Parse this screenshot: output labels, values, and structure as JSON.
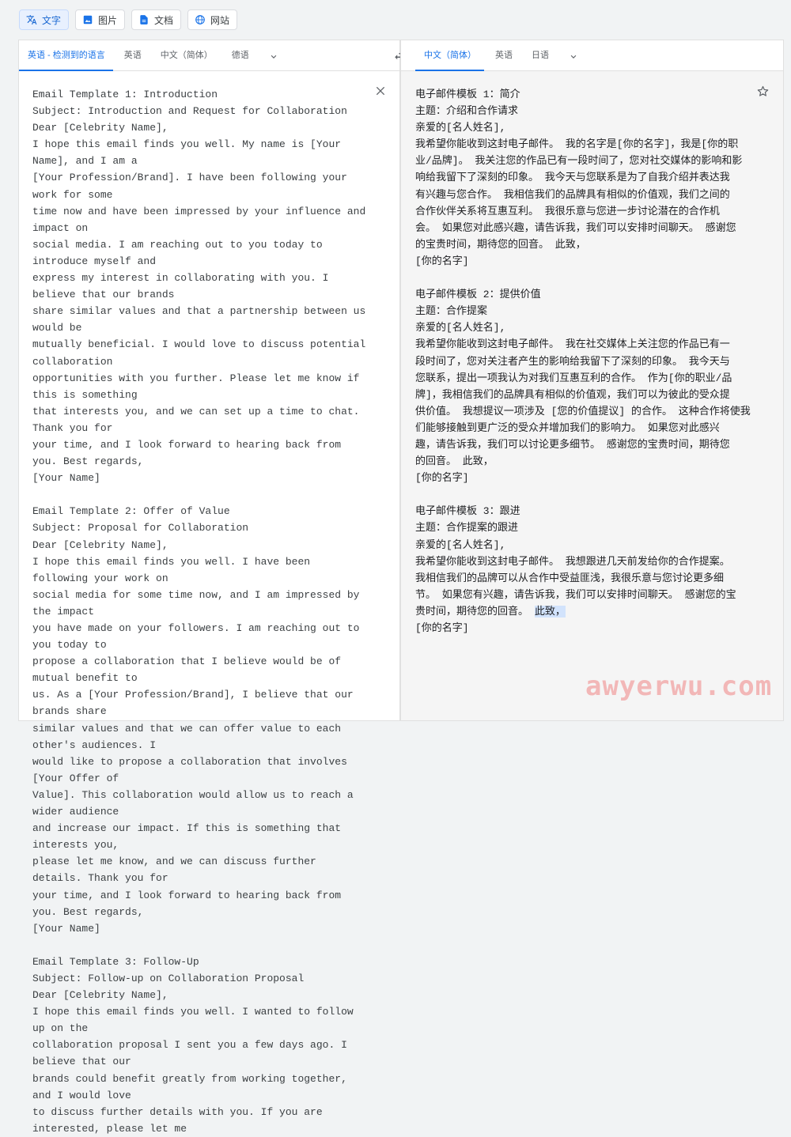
{
  "modes": [
    {
      "label": "文字",
      "icon": "translate-icon",
      "active": true
    },
    {
      "label": "图片",
      "icon": "image-icon",
      "active": false
    },
    {
      "label": "文档",
      "icon": "document-icon",
      "active": false
    },
    {
      "label": "网站",
      "icon": "globe-icon",
      "active": false
    }
  ],
  "source": {
    "tabs": [
      "英语 - 检测到的语言",
      "英语",
      "中文（简体）",
      "德语"
    ],
    "active_tab": 0,
    "lines": [
      "Email Template 1: Introduction",
      "Subject: Introduction and Request for Collaboration",
      "Dear [Celebrity Name],",
      "I hope this email finds you well. My name is [Your Name], and I am a",
      "[Your Profession/Brand]. I have been following your work for some",
      "time now and have been impressed by your influence and impact on",
      "social media. I am reaching out to you today to introduce myself and",
      "express my interest in collaborating with you. I believe that our brands",
      "share similar values and that a partnership between us would be",
      "mutually beneficial. I would love to discuss potential collaboration",
      "opportunities with you further. Please let me know if this is something",
      "that interests you, and we can set up a time to chat. Thank you for",
      "your time, and I look forward to hearing back from you. Best regards,",
      "[Your Name]",
      "",
      "Email Template 2: Offer of Value",
      "Subject: Proposal for Collaboration",
      "Dear [Celebrity Name],",
      "I hope this email finds you well. I have been following your work on",
      "social media for some time now, and I am impressed by the impact",
      "you have made on your followers. I am reaching out to you today to",
      "propose a collaboration that I believe would be of mutual benefit to",
      "us. As a [Your Profession/Brand], I believe that our brands share",
      "similar values and that we can offer value to each other's audiences. I",
      "would like to propose a collaboration that involves [Your Offer of",
      "Value]. This collaboration would allow us to reach a wider audience",
      "and increase our impact. If this is something that interests you,",
      "please let me know, and we can discuss further details. Thank you for",
      "your time, and I look forward to hearing back from you. Best regards,",
      "[Your Name]",
      "",
      "Email Template 3: Follow-Up",
      "Subject: Follow-up on Collaboration Proposal",
      "Dear [Celebrity Name],",
      "I hope this email finds you well. I wanted to follow up on the",
      "collaboration proposal I sent you a few days ago. I believe that our",
      "brands could benefit greatly from working together, and I would love",
      "to discuss further details with you. If you are interested, please let me"
    ]
  },
  "target": {
    "tabs": [
      "中文（简体）",
      "英语",
      "日语"
    ],
    "active_tab": 0,
    "lines": [
      "电子邮件模板 1：简介",
      "主题：介绍和合作请求",
      "亲爱的[名人姓名],",
      "我希望你能收到这封电子邮件。 我的名字是[你的名字]，我是[你的职",
      "业/品牌]。 我关注您的作品已有一段时间了，您对社交媒体的影响和影",
      "响给我留下了深刻的印象。 我今天与您联系是为了自我介绍并表达我",
      "有兴趣与您合作。 我相信我们的品牌具有相似的价值观，我们之间的",
      "合作伙伴关系将互惠互利。 我很乐意与您进一步讨论潜在的合作机",
      "会。 如果您对此感兴趣，请告诉我，我们可以安排时间聊天。 感谢您",
      "的宝贵时间，期待您的回音。 此致，",
      "[你的名字]",
      "",
      "电子邮件模板 2：提供价值",
      "主题：合作提案",
      "亲爱的[名人姓名],",
      "我希望你能收到这封电子邮件。 我在社交媒体上关注您的作品已有一",
      "段时间了，您对关注者产生的影响给我留下了深刻的印象。 我今天与",
      "您联系，提出一项我认为对我们互惠互利的合作。 作为[你的职业/品",
      "牌]，我相信我们的品牌具有相似的价值观，我们可以为彼此的受众提",
      "供价值。 我想提议一项涉及 [您的价值提议] 的合作。 这种合作将使我",
      "们能够接触到更广泛的受众并增加我们的影响力。 如果您对此感兴",
      "趣，请告诉我，我们可以讨论更多细节。 感谢您的宝贵时间，期待您",
      "的回音。 此致，",
      "[你的名字]",
      "",
      "电子邮件模板 3：跟进",
      "主题：合作提案的跟进",
      "亲爱的[名人姓名],",
      "我希望你能收到这封电子邮件。 我想跟进几天前发给你的合作提案。",
      "我相信我们的品牌可以从合作中受益匪浅，我很乐意与您讨论更多细",
      "节。 如果您有兴趣，请告诉我，我们可以安排时间聊天。 感谢您的宝",
      "贵时间，期待您的回音。 ",
      "[你的名字]"
    ],
    "highlight": "此致，"
  },
  "watermark": "awyerwu.com",
  "colors": {
    "accent": "#1a73e8",
    "active_mode_bg": "#e8f0fe"
  }
}
